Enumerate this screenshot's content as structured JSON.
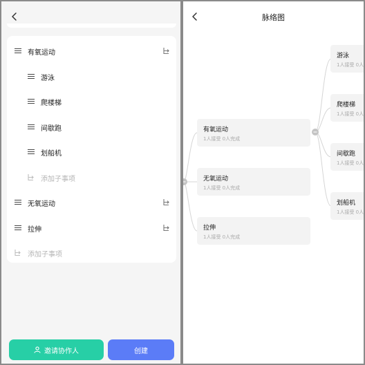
{
  "editor": {
    "items": [
      {
        "label": "有氧运动"
      },
      {
        "label": "游泳"
      },
      {
        "label": "爬楼梯"
      },
      {
        "label": "间歇跑"
      },
      {
        "label": "划船机"
      },
      {
        "label": "无氧运动"
      },
      {
        "label": "拉伸"
      }
    ],
    "add_child_label": "添加子事项",
    "invite_label": "邀请协作人",
    "create_label": "创建",
    "colors": {
      "invite": "#27cfa6",
      "create": "#5b7cf7"
    }
  },
  "mindmap": {
    "title": "脉络图",
    "nodes": [
      {
        "name": "有氧运动",
        "stats": "1人接受 0人完成"
      },
      {
        "name": "无氧运动",
        "stats": "1人接受 0人完成"
      },
      {
        "name": "拉伸",
        "stats": "1人接受 0人完成"
      },
      {
        "name": "游泳",
        "stats": "1人接受 0人"
      },
      {
        "name": "爬楼梯",
        "stats": "1人接受 0人"
      },
      {
        "name": "间歇跑",
        "stats": "1人接受 0人"
      },
      {
        "name": "划船机",
        "stats": "1人接受 0人"
      }
    ]
  }
}
